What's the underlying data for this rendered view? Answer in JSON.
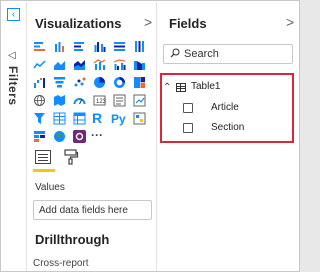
{
  "rail": {
    "collapse_icon": "collapse-left-icon",
    "filter_icon": "filter-chevron-icon",
    "label": "Filters"
  },
  "visualizations": {
    "title": "Visualizations",
    "chevron": ">",
    "icons": [
      "stacked-bar-chart",
      "stacked-column-chart",
      "clustered-bar-chart",
      "clustered-column-chart",
      "100-stacked-bar-chart",
      "100-stacked-column-chart",
      "line-chart",
      "area-chart",
      "stacked-area-chart",
      "line-and-stacked-column-chart",
      "line-and-clustered-column-chart",
      "ribbon-chart",
      "waterfall-chart",
      "funnel-chart",
      "scatter-chart",
      "pie-chart",
      "donut-chart",
      "treemap",
      "map",
      "filled-map",
      "gauge",
      "card",
      "multi-row-card",
      "kpi",
      "slicer",
      "table",
      "matrix",
      "r-script-visual",
      "python-visual",
      "key-influencers",
      "decomposition-tree",
      "globe-map",
      "power-apps",
      "more-visuals"
    ],
    "more_label": "···",
    "r_label": "R",
    "py_label": "Py",
    "tabs": {
      "fields_tab": "fields-tab-icon",
      "format_tab": "paint-roller-icon"
    },
    "values_label": "Values",
    "add_field_placeholder": "Add data fields here",
    "drillthrough_title": "Drillthrough",
    "cross_report_label": "Cross-report"
  },
  "fields": {
    "title": "Fields",
    "chevron": ">",
    "search_placeholder": "Search",
    "table": {
      "caret": "⌃",
      "name": "Table1"
    },
    "items": [
      {
        "label": "Article"
      },
      {
        "label": "Section"
      }
    ]
  },
  "colors": {
    "accent_blue": "#118dff",
    "underline_yellow": "#f2c811",
    "highlight_red": "#d9263a"
  }
}
